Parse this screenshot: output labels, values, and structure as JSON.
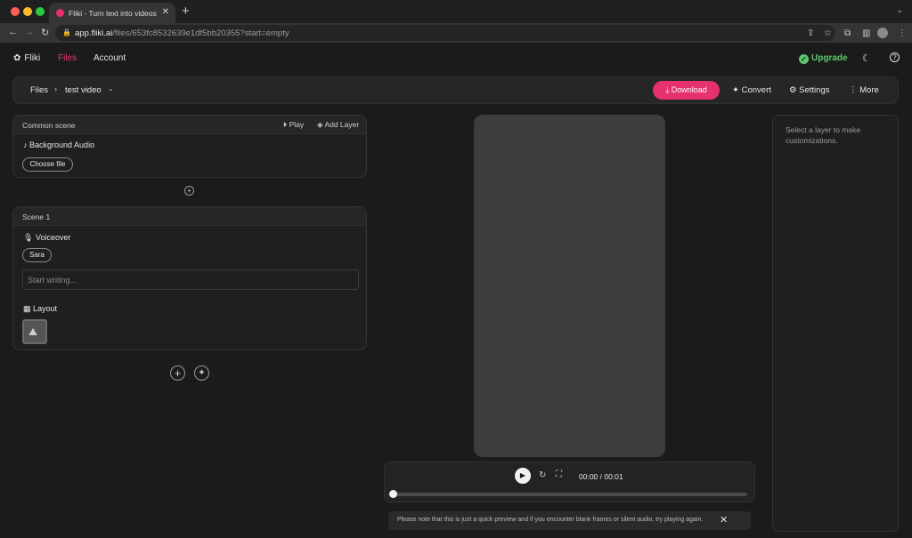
{
  "browser": {
    "tab_title": "Fliki - Turn text into videos wi",
    "url_host": "app.fliki.ai",
    "url_path": "/files/653fc8532639e1df5bb20355?start=empty"
  },
  "topnav": {
    "brand": "Fliki",
    "files": "Files",
    "account": "Account",
    "upgrade": "Upgrade"
  },
  "toolbar": {
    "crumb_root": "Files",
    "crumb_sep": "›",
    "file_name": "test video",
    "download": "Download",
    "convert": "Convert",
    "settings": "Settings",
    "more": "More"
  },
  "common_scene": {
    "title": "Common scene",
    "play": "Play",
    "add_layer": "Add Layer",
    "background_audio_label": "Background Audio",
    "choose_file": "Choose file"
  },
  "scene1": {
    "title": "Scene 1",
    "voiceover_label": "Voiceover",
    "voice": "Sara",
    "placeholder": "Start writing...",
    "layout_label": "Layout"
  },
  "player": {
    "time": "00:00 / 00:01",
    "progress": 0
  },
  "notice": "Please note that this is just a quick preview and if you encounter blank frames or silent audio, try playing again.",
  "right_panel": {
    "hint": "Select a layer to make customizations."
  },
  "colors": {
    "accent": "#e5316c",
    "upgrade": "#5cc76a",
    "background": "#1b1b1b"
  }
}
